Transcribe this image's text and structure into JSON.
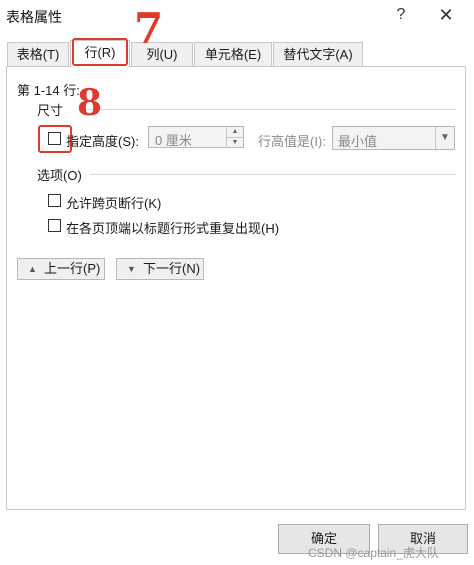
{
  "window": {
    "title": "表格属性",
    "help": "?",
    "close": "✕"
  },
  "tabs": [
    {
      "label": "表格(T)"
    },
    {
      "label": "行(R)"
    },
    {
      "label": "列(U)"
    },
    {
      "label": "单元格(E)"
    },
    {
      "label": "替代文字(A)"
    }
  ],
  "row_tab": {
    "rows_label": "第 1-14 行:",
    "size_section": "尺寸",
    "specify_height_label": "指定高度(S):",
    "height_value": "0 厘米",
    "row_height_is_label": "行高值是(I):",
    "row_height_option": "最小值",
    "options_section": "选项(O)",
    "allow_break_label": "允许跨页断行(K)",
    "repeat_header_label": "在各页顶端以标题行形式重复出现(H)",
    "prev_row": "上一行(P)",
    "next_row": "下一行(N)"
  },
  "footer": {
    "ok": "确定",
    "cancel": "取消"
  },
  "annotations": {
    "tab_marker": "7",
    "checkbox_marker": "8"
  },
  "watermark": "CSDN @captain_虎大队",
  "colors": {
    "annotation_red": "#e03a2f",
    "panel_border": "#c8c8c8",
    "disabled_text": "#8a8a8a"
  }
}
